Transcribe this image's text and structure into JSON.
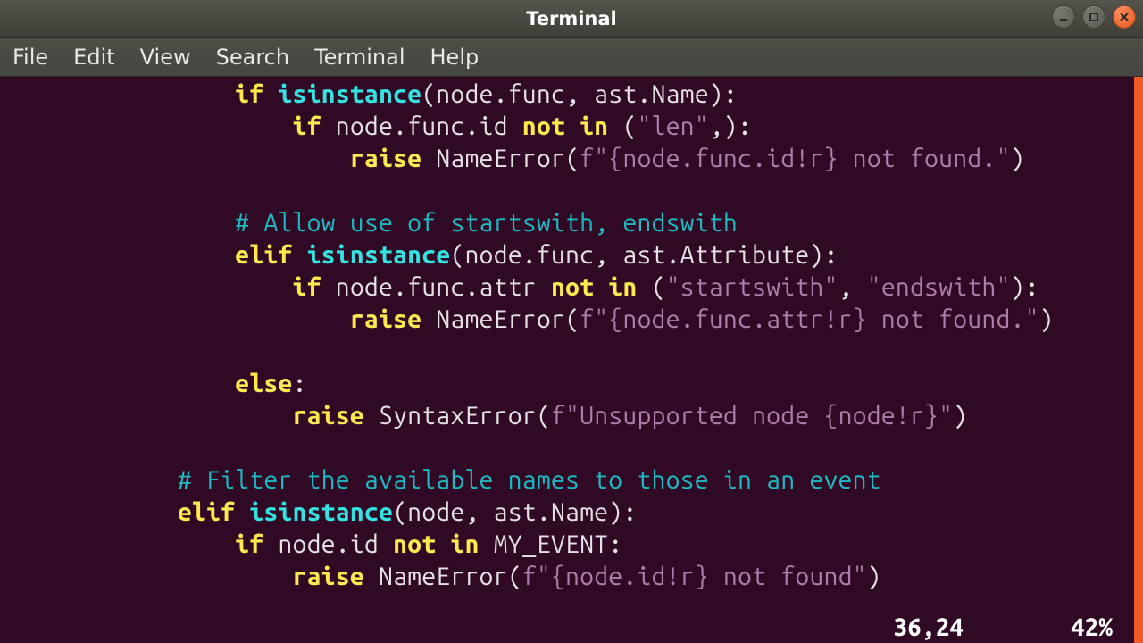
{
  "window": {
    "title": "Terminal"
  },
  "menubar": {
    "items": [
      "File",
      "Edit",
      "View",
      "Search",
      "Terminal",
      "Help"
    ]
  },
  "editor": {
    "lines": [
      {
        "indent": 16,
        "segments": [
          {
            "cls": "kw",
            "t": "if "
          },
          {
            "cls": "bi",
            "t": "isinstance"
          },
          {
            "cls": "ident",
            "t": "(node.func, ast.Name):"
          }
        ]
      },
      {
        "indent": 20,
        "segments": [
          {
            "cls": "kw",
            "t": "if"
          },
          {
            "cls": "ident",
            "t": " node.func.id "
          },
          {
            "cls": "kw",
            "t": "not in"
          },
          {
            "cls": "ident",
            "t": " ("
          },
          {
            "cls": "str",
            "t": "\"len\""
          },
          {
            "cls": "ident",
            "t": ",):"
          }
        ]
      },
      {
        "indent": 24,
        "segments": [
          {
            "cls": "kw",
            "t": "raise"
          },
          {
            "cls": "ident",
            "t": " "
          },
          {
            "cls": "excn",
            "t": "NameError"
          },
          {
            "cls": "ident",
            "t": "("
          },
          {
            "cls": "str",
            "t": "f\"{node.func.id!r} not found.\""
          },
          {
            "cls": "ident",
            "t": ")"
          }
        ]
      },
      {
        "indent": 0,
        "segments": []
      },
      {
        "indent": 16,
        "segments": [
          {
            "cls": "cmt",
            "t": "# Allow use of startswith, endswith"
          }
        ]
      },
      {
        "indent": 16,
        "segments": [
          {
            "cls": "kw",
            "t": "elif "
          },
          {
            "cls": "bi",
            "t": "isinstance"
          },
          {
            "cls": "ident",
            "t": "(node.func, ast.Attribute):"
          }
        ]
      },
      {
        "indent": 20,
        "segments": [
          {
            "cls": "kw",
            "t": "if"
          },
          {
            "cls": "ident",
            "t": " node.func.attr "
          },
          {
            "cls": "kw",
            "t": "not in"
          },
          {
            "cls": "ident",
            "t": " ("
          },
          {
            "cls": "str",
            "t": "\"startswith\""
          },
          {
            "cls": "ident",
            "t": ", "
          },
          {
            "cls": "str",
            "t": "\"endswith\""
          },
          {
            "cls": "ident",
            "t": "):"
          }
        ]
      },
      {
        "indent": 24,
        "segments": [
          {
            "cls": "kw",
            "t": "raise"
          },
          {
            "cls": "ident",
            "t": " "
          },
          {
            "cls": "excn",
            "t": "NameError"
          },
          {
            "cls": "ident",
            "t": "("
          },
          {
            "cls": "str",
            "t": "f\"{node.func.attr!r} not found.\""
          },
          {
            "cls": "ident",
            "t": ")"
          }
        ]
      },
      {
        "indent": 0,
        "segments": []
      },
      {
        "indent": 16,
        "segments": [
          {
            "cls": "kw",
            "t": "else"
          },
          {
            "cls": "ident",
            "t": ":"
          }
        ]
      },
      {
        "indent": 20,
        "segments": [
          {
            "cls": "kw",
            "t": "raise"
          },
          {
            "cls": "ident",
            "t": " "
          },
          {
            "cls": "excn",
            "t": "SyntaxError"
          },
          {
            "cls": "ident",
            "t": "("
          },
          {
            "cls": "str",
            "t": "f\"Unsupported node {node!r}\""
          },
          {
            "cls": "ident",
            "t": ")"
          }
        ]
      },
      {
        "indent": 0,
        "segments": []
      },
      {
        "indent": 12,
        "segments": [
          {
            "cls": "cmt",
            "t": "# Filter the available names to those in an event"
          }
        ]
      },
      {
        "indent": 12,
        "segments": [
          {
            "cls": "kw",
            "t": "elif "
          },
          {
            "cls": "bi",
            "t": "isinstance"
          },
          {
            "cls": "ident",
            "t": "(node, ast.Name):"
          }
        ]
      },
      {
        "indent": 16,
        "segments": [
          {
            "cls": "kw",
            "t": "if"
          },
          {
            "cls": "ident",
            "t": " node.id "
          },
          {
            "cls": "kw",
            "t": "not in"
          },
          {
            "cls": "ident",
            "t": " MY_EVENT:"
          }
        ]
      },
      {
        "indent": 20,
        "segments": [
          {
            "cls": "kw",
            "t": "raise"
          },
          {
            "cls": "ident",
            "t": " "
          },
          {
            "cls": "excn",
            "t": "NameError"
          },
          {
            "cls": "ident",
            "t": "("
          },
          {
            "cls": "str",
            "t": "f\"{node.id!r} not found\""
          },
          {
            "cls": "ident",
            "t": ")"
          }
        ]
      }
    ],
    "status": {
      "cursor": "36,24",
      "percent": "42%"
    }
  },
  "colors": {
    "terminal_bg": "#300a24",
    "scrollbar": "#f05a28",
    "keyword": "#fce94f",
    "builtin": "#34e2e2",
    "string": "#ad7fa8",
    "comment": "#1fb9c4",
    "foreground": "#e6e1e7"
  }
}
